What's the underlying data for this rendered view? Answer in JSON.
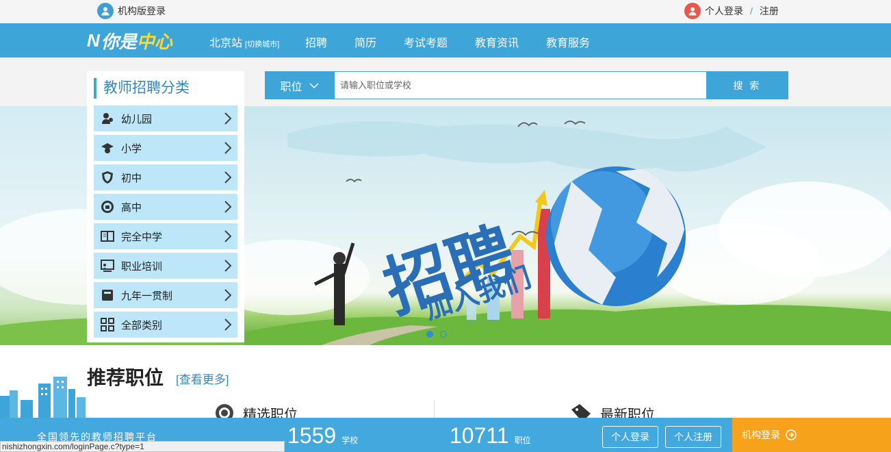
{
  "topbar": {
    "org_login": "机构版登录",
    "personal_login": "个人登录",
    "separator": "/",
    "register": "注册"
  },
  "nav": {
    "logo_n": "N",
    "logo_text_a": "你是",
    "logo_text_b": "中心",
    "city": "北京站",
    "switch_city": "[切换城市]",
    "items": [
      "招聘",
      "简历",
      "考试考题",
      "教育资讯",
      "教育服务"
    ]
  },
  "sidebar": {
    "title": "教师招聘分类",
    "items": [
      {
        "label": "幼儿园",
        "icon": "kindergarten-icon"
      },
      {
        "label": "小学",
        "icon": "graduation-cap-icon"
      },
      {
        "label": "初中",
        "icon": "shield-icon"
      },
      {
        "label": "高中",
        "icon": "badge-icon"
      },
      {
        "label": "完全中学",
        "icon": "book-icon"
      },
      {
        "label": "职业培训",
        "icon": "teacher-board-icon"
      },
      {
        "label": "九年一贯制",
        "icon": "notebook-icon"
      },
      {
        "label": "全部类别",
        "icon": "grid-icon"
      }
    ]
  },
  "search": {
    "type": "职位",
    "placeholder": "请输入职位或学校",
    "button": "搜 索"
  },
  "banner": {
    "dots": 2,
    "active_dot": 0
  },
  "recommend": {
    "title": "推荐职位",
    "more": "[查看更多]",
    "featured": "精选职位",
    "latest": "最新职位"
  },
  "bottombar": {
    "slogan": "全国领先的教师招聘平台",
    "schools_count": "1559",
    "schools_unit": "学校",
    "jobs_count": "10711",
    "jobs_unit": "职位",
    "personal_login": "个人登录",
    "personal_register": "个人注册",
    "org_login": "机构登录"
  },
  "status_url": "nishizhongxin.com/loginPage.c?type=1"
}
